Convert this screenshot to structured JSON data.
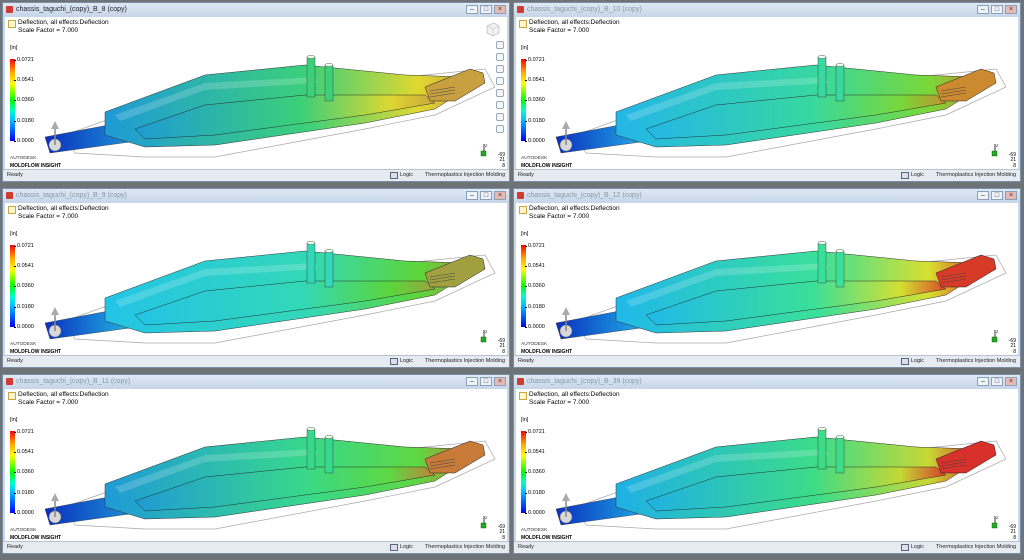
{
  "windows": [
    {
      "title": "chassis_taguchi_(copy)_B_8 (copy)",
      "active": true
    },
    {
      "title": "chassis_taguchi_(copy)_B_10 (copy)",
      "active": false
    },
    {
      "title": "chassis_taguchi_(copy)_B_9 (copy)",
      "active": false
    },
    {
      "title": "chassis_taguchi_(copy)_B_12 (copy)",
      "active": false
    },
    {
      "title": "chassis_taguchi_(copy)_B_11 (copy)",
      "active": false
    },
    {
      "title": "chassis_taguchi_(copy)_B_39 (copy)",
      "active": false
    }
  ],
  "result": {
    "name": "Deflection, all effects:Deflection",
    "scale": "Scale Factor = 7.000",
    "unit": "[in]",
    "legend_ticks": [
      "0.0721",
      "0.0541",
      "0.0360",
      "0.0180",
      "0.0000"
    ]
  },
  "brand": {
    "line1": "AUTODESK",
    "line2": "MOLDFLOW INSIGHT"
  },
  "view": {
    "triad_axis": "Z",
    "rotation": [
      "-69",
      "21",
      "8"
    ]
  },
  "status": {
    "left": "Ready",
    "units": "Logic",
    "mode": "Thermoplastics Injection Molding"
  },
  "window_buttons": {
    "minimize": "–",
    "maximize": "□",
    "close": "×"
  },
  "part_coloring": [
    {
      "body_start": "#1f9ad6",
      "body_mid": "#3cd07a",
      "body_end": "#e0d830",
      "tip": "#c8a040"
    },
    {
      "body_start": "#23b6e8",
      "body_mid": "#38d8a0",
      "body_end": "#7ad838",
      "tip": "#cc8a30"
    },
    {
      "body_start": "#23c4e6",
      "body_mid": "#33d8b8",
      "body_end": "#5cd63a",
      "tip": "#a0a040"
    },
    {
      "body_start": "#20b8ea",
      "body_mid": "#3ae09a",
      "body_end": "#d8e030",
      "tip": "#d83a28"
    },
    {
      "body_start": "#1f9ad6",
      "body_mid": "#38d88c",
      "body_end": "#5ed842",
      "tip": "#c87a38"
    },
    {
      "body_start": "#1fb0e6",
      "body_mid": "#3cdc88",
      "body_end": "#c8d834",
      "tip": "#d8302a"
    }
  ],
  "navbar_icons": [
    "orbit-icon",
    "pan-icon",
    "zoom-icon",
    "zoom-window-icon",
    "fit-icon",
    "section-icon",
    "layers-icon",
    "home-icon"
  ]
}
